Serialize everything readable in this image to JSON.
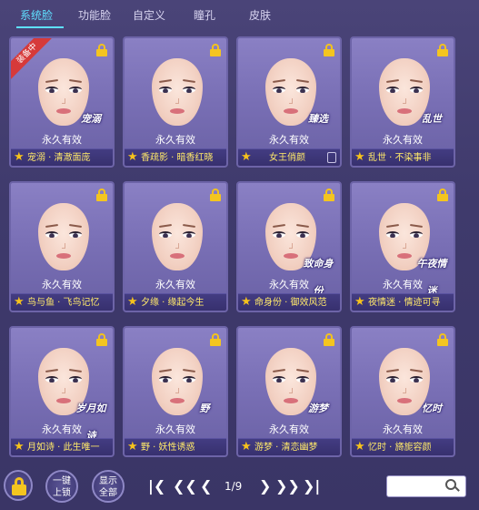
{
  "tabs": [
    {
      "label": "系统脸",
      "active": true
    },
    {
      "label": "功能脸",
      "active": false
    },
    {
      "label": "自定义",
      "active": false
    },
    {
      "label": "瞳孔",
      "active": false
    },
    {
      "label": "皮肤",
      "active": false
    }
  ],
  "cards": [
    {
      "validity": "永久有效",
      "name": "宠溺 · 清澈面庞",
      "badge": "宠溺",
      "ribbon": "装备中",
      "locked": true
    },
    {
      "validity": "永久有效",
      "name": "香疏影 · 暗香红晓",
      "badge": "",
      "locked": true
    },
    {
      "validity": "永久有效",
      "name": "女王俏颜",
      "badge": "臻选",
      "locked": true,
      "mini_lock": true
    },
    {
      "validity": "永久有效",
      "name": "乱世 · 不染事非",
      "badge": "乱世",
      "locked": true
    },
    {
      "validity": "永久有效",
      "name": "鸟与鱼 · 飞鸟记忆",
      "badge": "",
      "locked": true
    },
    {
      "validity": "永久有效",
      "name": "夕缘 · 缘起今生",
      "badge": "",
      "locked": true
    },
    {
      "validity": "永久有效",
      "name": "命身份 · 御效风范",
      "badge": "致命身份",
      "locked": true
    },
    {
      "validity": "永久有效",
      "name": "夜情迷 · 情迹可寻",
      "badge": "午夜情迷",
      "locked": true
    },
    {
      "validity": "永久有效",
      "name": "月如诗 · 此生唯一",
      "badge": "岁月如诗",
      "locked": true
    },
    {
      "validity": "永久有效",
      "name": "野 · 妖性诱惑",
      "badge": "野",
      "locked": true
    },
    {
      "validity": "永久有效",
      "name": "游梦 · 清恋幽梦",
      "badge": "游梦",
      "locked": true
    },
    {
      "validity": "永久有效",
      "name": "忆时 · 旖旎容颜",
      "badge": "忆时",
      "locked": true
    }
  ],
  "bottom": {
    "lock_all_label_1": "一键",
    "lock_all_label_2": "上锁",
    "show_all_label_1": "显示",
    "show_all_label_2": "全部",
    "page": "1/9",
    "search_placeholder": ""
  },
  "colors": {
    "accent": "#5fe0ff",
    "name_text": "#ffe96a",
    "star": "#f6c21c",
    "ribbon": "#d63a3a"
  }
}
